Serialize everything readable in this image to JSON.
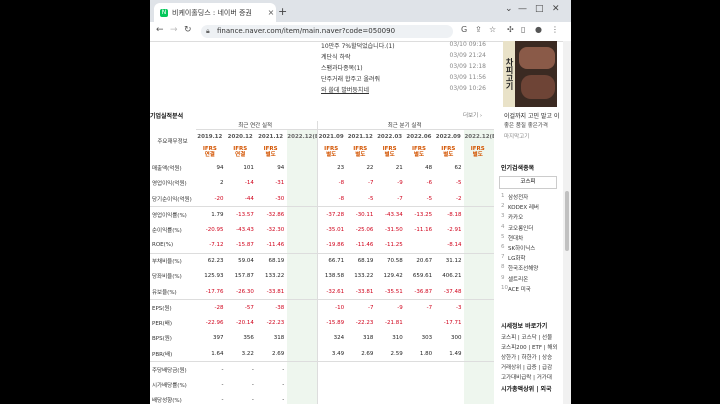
{
  "browser": {
    "tab_title": "비케이홀딩스 : 네이버 증권",
    "favicon_letter": "N",
    "url": "finance.naver.com/item/main.naver?code=050090",
    "new_tab": "+",
    "close_tab": "×",
    "min": "—",
    "restore": "□",
    "close": "✕",
    "chevron": "⌄"
  },
  "news": [
    {
      "title": "10만주 7%할덕었습니다.(1)",
      "date": "03/10 09:16",
      "link": false
    },
    {
      "title": "계단식 하락",
      "date": "03/09 21:24",
      "link": false
    },
    {
      "title": "스팸과다종목(1)",
      "date": "03/09 12:18",
      "link": false
    },
    {
      "title": "단주거래 합주고 올려줘",
      "date": "03/09 11:56",
      "link": false
    },
    {
      "title": "와 쓸데 발버둥치네",
      "date": "03/09 10:26",
      "link": true
    }
  ],
  "financials": {
    "title": "기업실적분석",
    "more": "더보기",
    "main_info": "주요재무정보",
    "annual_header": "최근 연간 실적",
    "quarter_header": "최근 분기 실적",
    "years": [
      "2019.12",
      "2020.12",
      "2021.12",
      "2022.12(E)",
      "2021.09",
      "2021.12",
      "2022.03",
      "2022.06",
      "2022.09",
      "2022.12(E)"
    ],
    "subs": [
      "IFRS\n연결",
      "IFRS\n연결",
      "IFRS\n별도",
      "",
      "IFRS\n별도",
      "IFRS\n별도",
      "IFRS\n별도",
      "IFRS\n별도",
      "IFRS\n별도",
      "IFRS\n별도"
    ],
    "rows": [
      {
        "label": "매출액(억원)",
        "values": [
          "94",
          "101",
          "94",
          "",
          "23",
          "22",
          "21",
          "48",
          "62",
          ""
        ]
      },
      {
        "label": "영업이익(억원)",
        "values": [
          "2",
          "-14",
          "-31",
          "",
          "-8",
          "-7",
          "-9",
          "-6",
          "-5",
          ""
        ]
      },
      {
        "label": "당기순이익(억원)",
        "values": [
          "-20",
          "-44",
          "-30",
          "",
          "-8",
          "-5",
          "-7",
          "-5",
          "-2",
          ""
        ]
      },
      {
        "label": "영업이익률(%)",
        "values": [
          "1.79",
          "-13.57",
          "-32.86",
          "",
          "-37.28",
          "-30.11",
          "-43.34",
          "-13.25",
          "-8.18",
          ""
        ]
      },
      {
        "label": "순이익률(%)",
        "values": [
          "-20.95",
          "-43.43",
          "-32.30",
          "",
          "-35.01",
          "-25.06",
          "-31.50",
          "-11.16",
          "-2.91",
          ""
        ]
      },
      {
        "label": "ROE(%)",
        "values": [
          "-7.12",
          "-15.87",
          "-11.46",
          "",
          "-19.86",
          "-11.46",
          "-11.25",
          "",
          "-8.14",
          ""
        ]
      },
      {
        "label": "부채비율(%)",
        "values": [
          "62.23",
          "59.04",
          "68.19",
          "",
          "66.71",
          "68.19",
          "70.58",
          "20.67",
          "31.12",
          ""
        ]
      },
      {
        "label": "당좌비율(%)",
        "values": [
          "125.93",
          "157.87",
          "133.22",
          "",
          "138.58",
          "133.22",
          "129.42",
          "659.61",
          "406.21",
          ""
        ]
      },
      {
        "label": "유보율(%)",
        "values": [
          "-17.76",
          "-26.30",
          "-33.81",
          "",
          "-32.61",
          "-33.81",
          "-35.51",
          "-36.87",
          "-37.48",
          ""
        ]
      },
      {
        "label": "EPS(원)",
        "values": [
          "-28",
          "-57",
          "-38",
          "",
          "-10",
          "-7",
          "-9",
          "-7",
          "-3",
          ""
        ]
      },
      {
        "label": "PER(배)",
        "values": [
          "-22.96",
          "-20.14",
          "-22.23",
          "",
          "-15.89",
          "-22.23",
          "-21.81",
          "",
          "-17.71",
          ""
        ]
      },
      {
        "label": "BPS(원)",
        "values": [
          "397",
          "356",
          "318",
          "",
          "324",
          "318",
          "310",
          "303",
          "300",
          ""
        ]
      },
      {
        "label": "PBR(배)",
        "values": [
          "1.64",
          "3.22",
          "2.69",
          "",
          "3.49",
          "2.69",
          "2.59",
          "1.80",
          "1.49",
          ""
        ]
      },
      {
        "label": "주당배당금(원)",
        "values": [
          "-",
          "-",
          "-",
          "",
          "",
          "",
          "",
          "",
          "",
          ""
        ]
      },
      {
        "label": "시가배당률(%)",
        "values": [
          "-",
          "-",
          "-",
          "",
          "",
          "",
          "",
          "",
          "",
          ""
        ]
      },
      {
        "label": "배당성향(%)",
        "values": [
          "-",
          "-",
          "-",
          "",
          "",
          "",
          "",
          "",
          "",
          ""
        ]
      }
    ]
  },
  "sidebar": {
    "ad_word": "차피고기",
    "ad_line1": "이걸까지 고민 말고 이",
    "ad_line2": "좋은 품질 좋은가격",
    "ad_line3": "마지막고기",
    "popular_title": "인기검색종목",
    "kospi_tab": "코스피",
    "popular": [
      {
        "n": "1",
        "name": "삼성전자"
      },
      {
        "n": "2",
        "name": "KODEX 레버"
      },
      {
        "n": "3",
        "name": "카카오"
      },
      {
        "n": "4",
        "name": "코오롱인더"
      },
      {
        "n": "5",
        "name": "현대차"
      },
      {
        "n": "6",
        "name": "SK하이닉스"
      },
      {
        "n": "7",
        "name": "LG화학"
      },
      {
        "n": "8",
        "name": "한국조선해양"
      },
      {
        "n": "9",
        "name": "셀트리온"
      },
      {
        "n": "10",
        "name": "ACE 미국"
      }
    ],
    "market_title": "시세정보 바로가기",
    "links": [
      "코스피 | 코스닥 | 선물",
      "코스피200 | ETF | 해외",
      "상한가 | 하한가 | 상승",
      "거래상위 | 급증 | 급감",
      "고가대비급락 | 거가대"
    ],
    "cap_title": "시가총액상위 | 외국"
  }
}
